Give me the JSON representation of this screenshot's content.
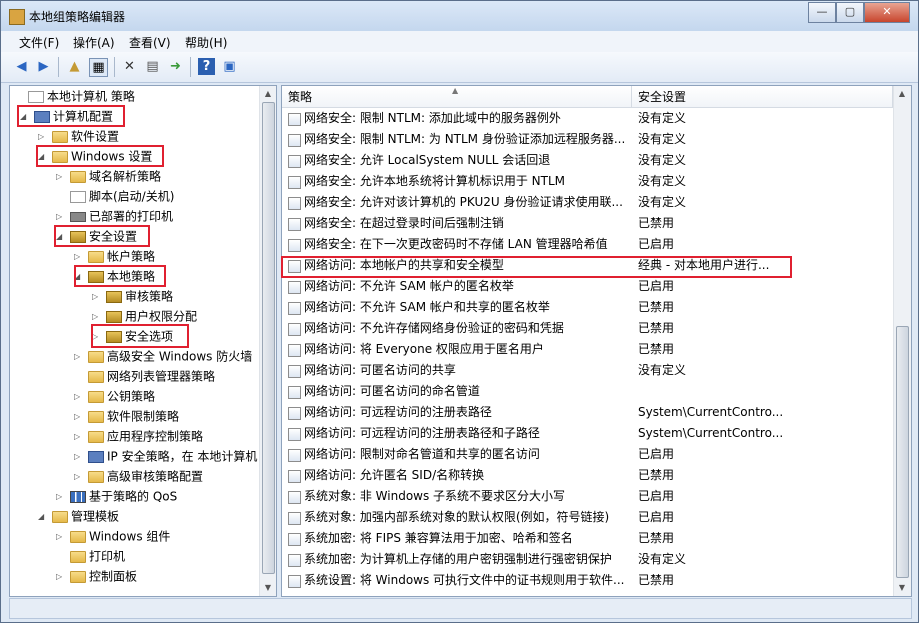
{
  "window": {
    "title": "本地组策略编辑器",
    "controls": [
      "—",
      "▢",
      "✕"
    ]
  },
  "menu": [
    "文件(F)",
    "操作(A)",
    "查看(V)",
    "帮助(H)"
  ],
  "tree": {
    "items": [
      {
        "label": "本地计算机 策略",
        "icon": "policy-doc-icon"
      },
      {
        "label": "计算机配置",
        "icon": "computer-icon"
      },
      {
        "label": "软件设置",
        "icon": "folder-icon"
      },
      {
        "label": "Windows 设置",
        "icon": "folder-icon"
      },
      {
        "label": "域名解析策略",
        "icon": "folder-icon"
      },
      {
        "label": "脚本(启动/关机)",
        "icon": "script-icon"
      },
      {
        "label": "已部署的打印机",
        "icon": "printer-icon"
      },
      {
        "label": "安全设置",
        "icon": "security-icon"
      },
      {
        "label": "帐户策略",
        "icon": "folder-icon"
      },
      {
        "label": "本地策略",
        "icon": "folder-icon"
      },
      {
        "label": "审核策略",
        "icon": "folder-icon"
      },
      {
        "label": "用户权限分配",
        "icon": "folder-icon"
      },
      {
        "label": "安全选项",
        "icon": "folder-icon"
      },
      {
        "label": "高级安全 Windows 防火墙",
        "icon": "folder-icon"
      },
      {
        "label": "网络列表管理器策略",
        "icon": "folder-icon"
      },
      {
        "label": "公钥策略",
        "icon": "folder-icon"
      },
      {
        "label": "软件限制策略",
        "icon": "folder-icon"
      },
      {
        "label": "应用程序控制策略",
        "icon": "folder-icon"
      },
      {
        "label": "IP 安全策略，在 本地计算机",
        "icon": "ipsec-icon"
      },
      {
        "label": "高级审核策略配置",
        "icon": "folder-icon"
      },
      {
        "label": "基于策略的 QoS",
        "icon": "chart-icon"
      },
      {
        "label": "管理模板",
        "icon": "folder-icon"
      },
      {
        "label": "Windows 组件",
        "icon": "folder-icon"
      },
      {
        "label": "打印机",
        "icon": "folder-icon"
      },
      {
        "label": "控制面板",
        "icon": "folder-icon"
      }
    ]
  },
  "list": {
    "columns": [
      "策略",
      "安全设置"
    ],
    "rows": [
      [
        "网络安全: 限制 NTLM: 添加此域中的服务器例外",
        "没有定义"
      ],
      [
        "网络安全: 限制 NTLM: 为 NTLM 身份验证添加远程服务器...",
        "没有定义"
      ],
      [
        "网络安全: 允许 LocalSystem NULL 会话回退",
        "没有定义"
      ],
      [
        "网络安全: 允许本地系统将计算机标识用于 NTLM",
        "没有定义"
      ],
      [
        "网络安全: 允许对该计算机的 PKU2U 身份验证请求使用联...",
        "没有定义"
      ],
      [
        "网络安全: 在超过登录时间后强制注销",
        "已禁用"
      ],
      [
        "网络安全: 在下一次更改密码时不存储 LAN 管理器哈希值",
        "已启用"
      ],
      [
        "网络访问: 本地帐户的共享和安全模型",
        "经典 - 对本地用户进行..."
      ],
      [
        "网络访问: 不允许 SAM 帐户的匿名枚举",
        "已启用"
      ],
      [
        "网络访问: 不允许 SAM 帐户和共享的匿名枚举",
        "已禁用"
      ],
      [
        "网络访问: 不允许存储网络身份验证的密码和凭据",
        "已禁用"
      ],
      [
        "网络访问: 将 Everyone 权限应用于匿名用户",
        "已禁用"
      ],
      [
        "网络访问: 可匿名访问的共享",
        "没有定义"
      ],
      [
        "网络访问: 可匿名访问的命名管道",
        ""
      ],
      [
        "网络访问: 可远程访问的注册表路径",
        "System\\CurrentContro..."
      ],
      [
        "网络访问: 可远程访问的注册表路径和子路径",
        "System\\CurrentContro..."
      ],
      [
        "网络访问: 限制对命名管道和共享的匿名访问",
        "已启用"
      ],
      [
        "网络访问: 允许匿名 SID/名称转换",
        "已禁用"
      ],
      [
        "系统对象: 非 Windows 子系统不要求区分大小写",
        "已启用"
      ],
      [
        "系统对象: 加强内部系统对象的默认权限(例如，符号链接)",
        "已启用"
      ],
      [
        "系统加密: 将 FIPS 兼容算法用于加密、哈希和签名",
        "已禁用"
      ],
      [
        "系统加密: 为计算机上存储的用户密钥强制进行强密钥保护",
        "没有定义"
      ],
      [
        "系统设置: 将 Windows 可执行文件中的证书规则用于软件...",
        "已禁用"
      ]
    ]
  },
  "colors": {
    "highlight_box": "#e02030",
    "chrome": "#dfe9f5"
  }
}
